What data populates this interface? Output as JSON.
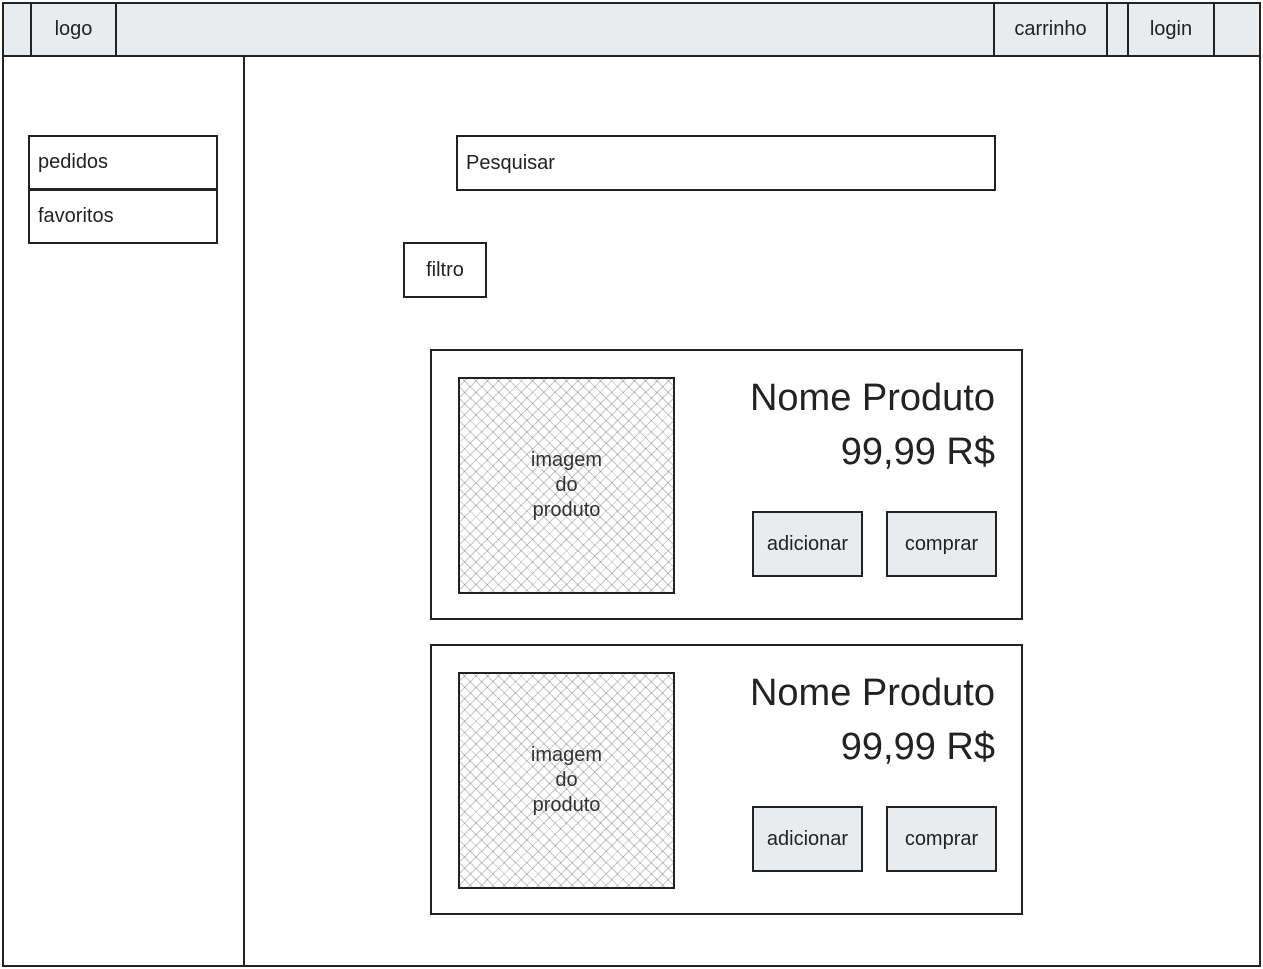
{
  "header": {
    "logo_label": "logo",
    "cart_label": "carrinho",
    "login_label": "login"
  },
  "sidebar": {
    "items": [
      {
        "label": "pedidos"
      },
      {
        "label": "favoritos"
      }
    ]
  },
  "search": {
    "placeholder": "Pesquisar"
  },
  "filter": {
    "label": "filtro"
  },
  "products": [
    {
      "image_line1": "imagem",
      "image_line2": "do",
      "image_line3": "produto",
      "name": "Nome Produto",
      "price": "99,99 R$",
      "add_label": "adicionar",
      "buy_label": "comprar"
    },
    {
      "image_line1": "imagem",
      "image_line2": "do",
      "image_line3": "produto",
      "name": "Nome Produto",
      "price": "99,99 R$",
      "add_label": "adicionar",
      "buy_label": "comprar"
    }
  ],
  "colors": {
    "toolbar_bg": "#e9ecee",
    "border": "#222222"
  }
}
